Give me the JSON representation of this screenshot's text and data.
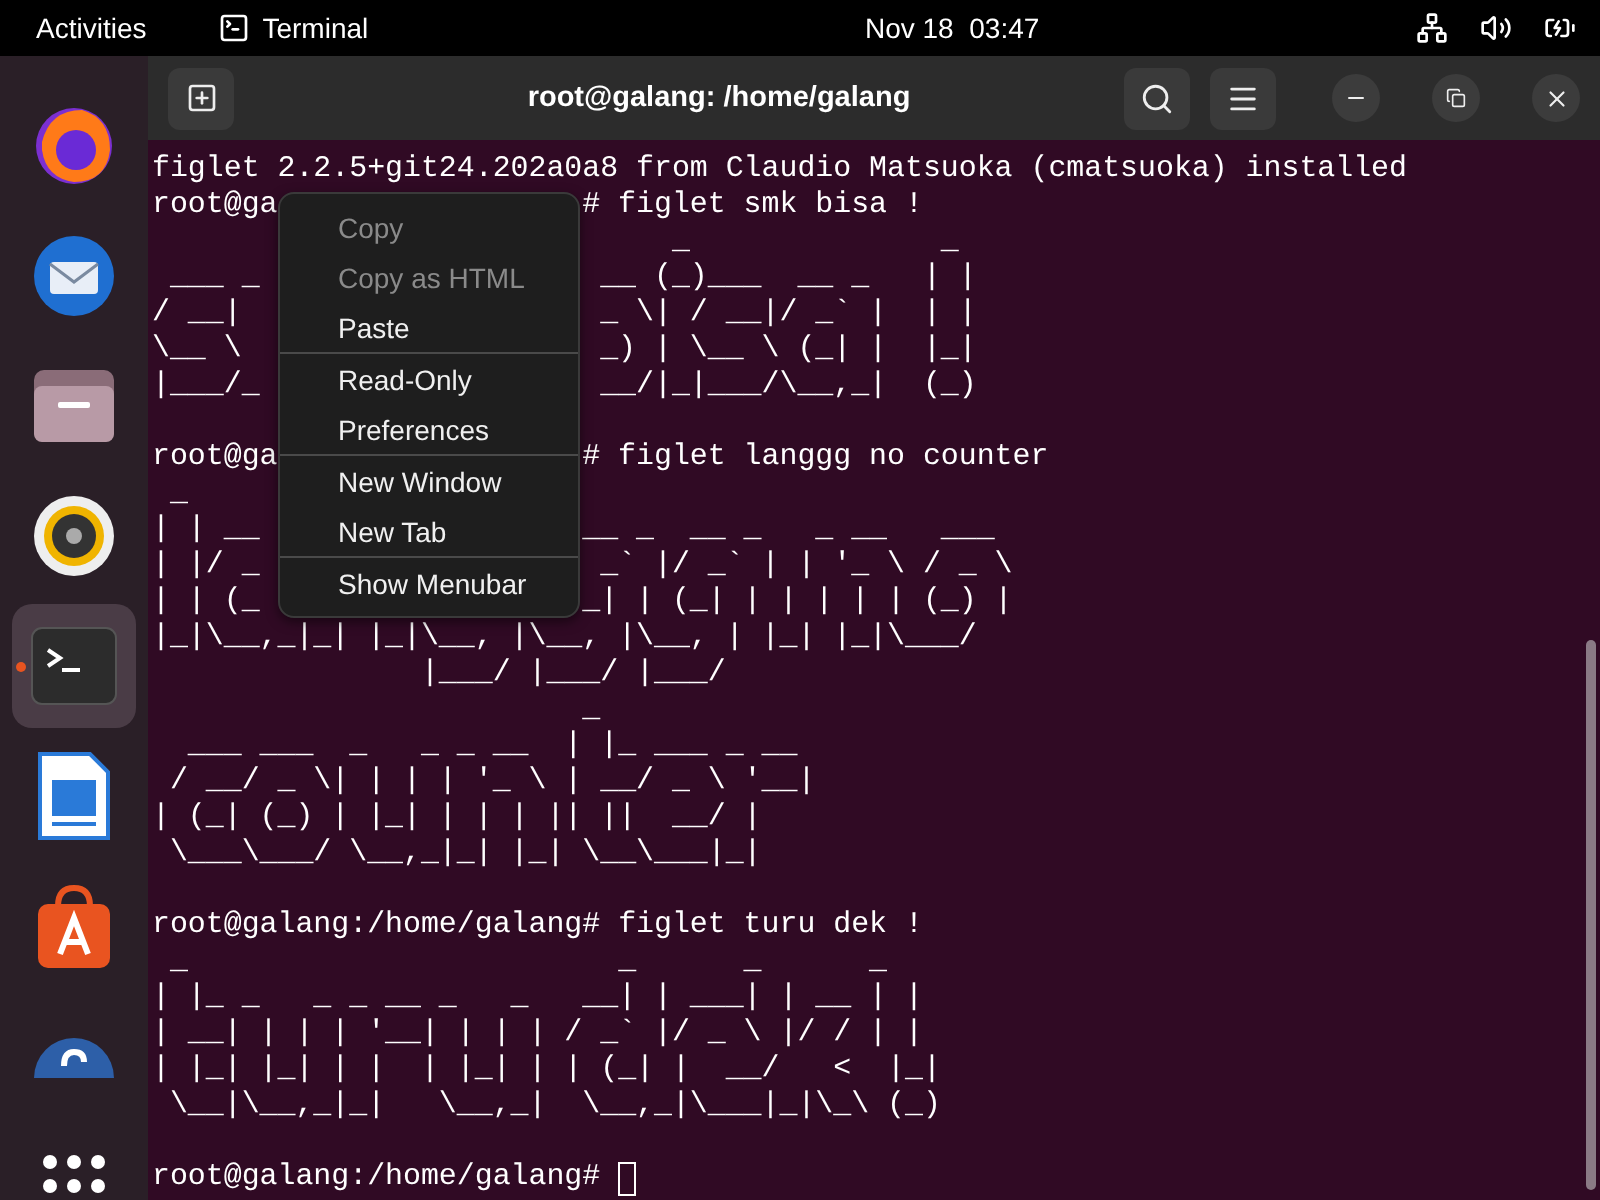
{
  "top_bar": {
    "activities": "Activities",
    "app": "Terminal",
    "clock": "Nov 18  03:47"
  },
  "dock": [
    {
      "kind": "browser",
      "selected": false
    },
    {
      "kind": "mail",
      "selected": false
    },
    {
      "kind": "files",
      "selected": false
    },
    {
      "kind": "music",
      "selected": false
    },
    {
      "kind": "terminal",
      "selected": true
    },
    {
      "kind": "writer",
      "selected": false
    },
    {
      "kind": "store",
      "selected": false
    },
    {
      "kind": "help",
      "selected": false
    },
    {
      "kind": "apps",
      "selected": false
    }
  ],
  "terminal": {
    "title": "root@galang: /home/galang",
    "output": [
      {
        "kind": "text",
        "text": "figlet 2.2.5+git24.202a0a8 from Claudio Matsuoka (cmatsuoka) installed"
      },
      {
        "kind": "prompt",
        "left": "root@ga",
        "right": "# figlet smk bisa !",
        "cursor": false
      },
      {
        "kind": "art",
        "right": "     _              _"
      },
      {
        "kind": "art",
        "left": " ___ _",
        "right": " __ (_)___  __ _   | |"
      },
      {
        "kind": "art",
        "left": "/ __|",
        "right": " _ \\| / __|/ _` |  | |"
      },
      {
        "kind": "art",
        "left": "\\__ \\",
        "right": " _) | \\__ \\ (_| |  |_|"
      },
      {
        "kind": "art",
        "left": "|___/_",
        "right": " __/|_|___/\\__,_|  (_)"
      },
      {
        "kind": "blank"
      },
      {
        "kind": "prompt",
        "left": "root@ga",
        "right": "# figlet langgg no counter",
        "cursor": false
      },
      {
        "kind": "art",
        "left": " _"
      },
      {
        "kind": "art",
        "left": "| | __",
        "right": "__ _  __ _   _ __   ___"
      },
      {
        "kind": "art",
        "left": "| |/ _",
        "right": " _` |/ _` | | '_ \\ / _ \\"
      },
      {
        "kind": "art",
        "left": "| | (_",
        "right": "_| | (_| | | | | | (_) |"
      },
      {
        "kind": "art",
        "text": "|_|\\__,_|_| |_|\\__, |\\__, |\\__, | |_| |_|\\___/"
      },
      {
        "kind": "art",
        "text": "               |___/ |___/ |___/"
      },
      {
        "kind": "art",
        "text": "                        _"
      },
      {
        "kind": "art",
        "text": "  ___ ___  _   _ _ __  | |_ ___ _ __"
      },
      {
        "kind": "art",
        "text": " / __/ _ \\| | | | '_ \\ | __/ _ \\ '__|"
      },
      {
        "kind": "art",
        "text": "| (_| (_) | |_| | | | || ||  __/ |"
      },
      {
        "kind": "art",
        "text": " \\___\\___/ \\__,_|_| |_| \\__\\___|_|"
      },
      {
        "kind": "blank"
      },
      {
        "kind": "prompt",
        "text": "root@galang:/home/galang# figlet turu dek !",
        "cursor": false
      },
      {
        "kind": "art",
        "text": " _                        _      _      _"
      },
      {
        "kind": "art",
        "text": "| |_ _   _ _ __ _   _   __| | ___| | __ | |"
      },
      {
        "kind": "art",
        "text": "| __| | | | '__| | | | / _` |/ _ \\ |/ / | |"
      },
      {
        "kind": "art",
        "text": "| |_| |_| | |  | |_| | | (_| |  __/   <  |_|"
      },
      {
        "kind": "art",
        "text": " \\__|\\__,_|_|   \\__,_|  \\__,_|\\___|_|\\_\\ (_)"
      },
      {
        "kind": "blank"
      },
      {
        "kind": "prompt",
        "text": "root@galang:/home/galang# ",
        "cursor": true
      }
    ]
  },
  "context_menu": [
    [
      {
        "label": "Copy",
        "disabled": true
      },
      {
        "label": "Copy as HTML",
        "disabled": true
      },
      {
        "label": "Paste",
        "disabled": false
      }
    ],
    [
      {
        "label": "Read-Only",
        "disabled": false
      },
      {
        "label": "Preferences",
        "disabled": false
      }
    ],
    [
      {
        "label": "New Window",
        "disabled": false
      },
      {
        "label": "New Tab",
        "disabled": false
      }
    ],
    [
      {
        "label": "Show Menubar",
        "disabled": false
      }
    ]
  ]
}
